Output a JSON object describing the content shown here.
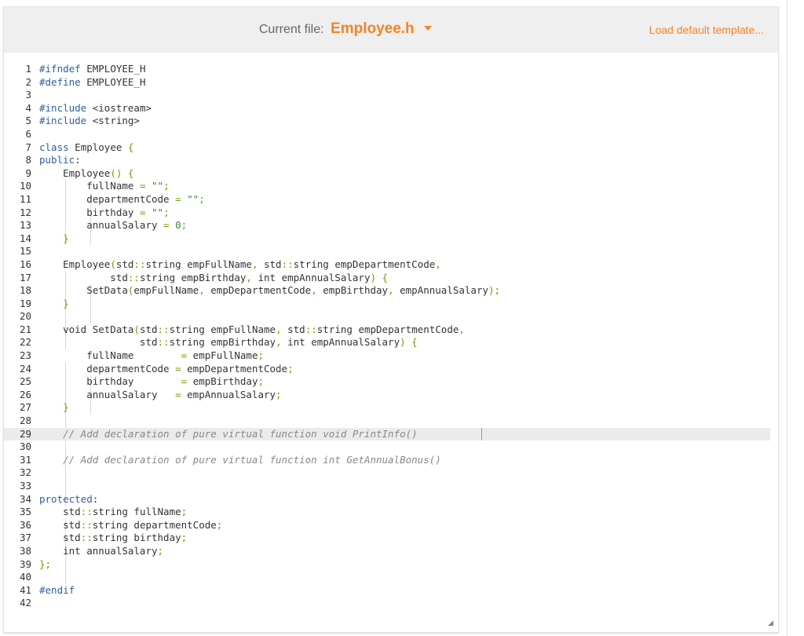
{
  "header": {
    "current_file_label": "Current file:",
    "current_file_name": "Employee.h",
    "load_template": "Load default template..."
  },
  "editor": {
    "active_line": 29,
    "lines": [
      "#ifndef EMPLOYEE_H",
      "#define EMPLOYEE_H",
      "",
      "#include <iostream>",
      "#include <string>",
      "",
      "class Employee {",
      "public:",
      "    Employee() {",
      "        fullName = \"\";",
      "        departmentCode = \"\";",
      "        birthday = \"\";",
      "        annualSalary = 0;",
      "    }",
      "",
      "    Employee(std::string empFullName, std::string empDepartmentCode,",
      "            std::string empBirthday, int empAnnualSalary) {",
      "        SetData(empFullName, empDepartmentCode, empBirthday, empAnnualSalary);",
      "    }",
      "",
      "    void SetData(std::string empFullName, std::string empDepartmentCode,",
      "                 std::string empBirthday, int empAnnualSalary) {",
      "        fullName        = empFullName;",
      "        departmentCode = empDepartmentCode;",
      "        birthday        = empBirthday;",
      "        annualSalary   = empAnnualSalary;",
      "    }",
      "",
      "    // Add declaration of pure virtual function void PrintInfo()",
      "",
      "    // Add declaration of pure virtual function int GetAnnualBonus()",
      "",
      "",
      "protected:",
      "    std::string fullName;",
      "    std::string departmentCode;",
      "    std::string birthday;",
      "    int annualSalary;",
      "};",
      "",
      "#endif",
      ""
    ]
  }
}
